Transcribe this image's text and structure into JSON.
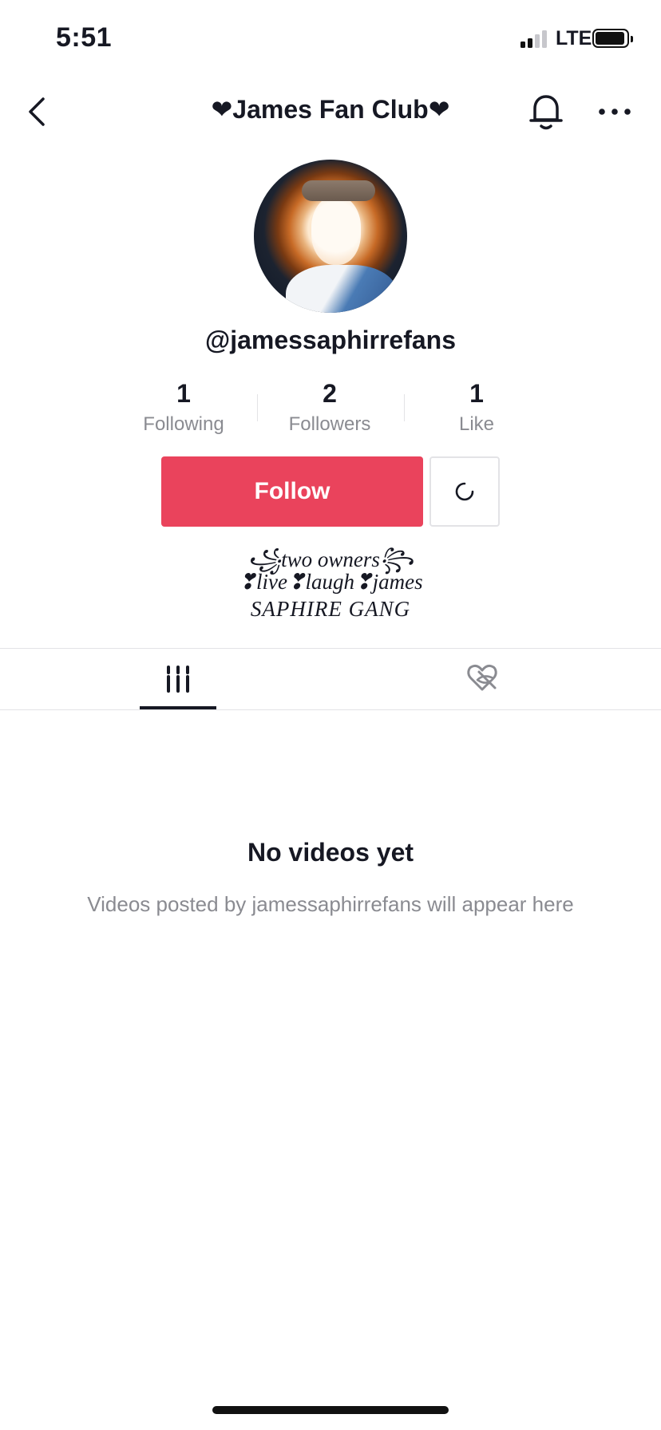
{
  "status_bar": {
    "time": "5:51",
    "network": "LTE",
    "signal_icon": "cellular-signal-icon",
    "battery_icon": "battery-icon"
  },
  "nav": {
    "title": "❤James Fan Club❤",
    "back_icon": "chevron-left-icon",
    "bell_icon": "bell-icon",
    "more_icon": "more-dots-icon"
  },
  "profile": {
    "handle": "@jamessaphirrefans",
    "stats": [
      {
        "value": "1",
        "label": "Following"
      },
      {
        "value": "2",
        "label": "Followers"
      },
      {
        "value": "1",
        "label": "Like"
      }
    ],
    "follow_label": "Follow",
    "bio": [
      "꧁two owners꧂",
      "❣live❣laugh❣james",
      "SAPHIRE GANG"
    ]
  },
  "tabs": [
    {
      "name": "videos",
      "icon": "grid-lines-icon",
      "active": true
    },
    {
      "name": "liked",
      "icon": "heart-hidden-icon",
      "active": false
    }
  ],
  "empty_state": {
    "title": "No videos yet",
    "subtitle": "Videos posted by jamessaphirrefans will appear here"
  },
  "colors": {
    "accent": "#ea435c",
    "text": "#161823",
    "muted": "#8a8b91",
    "divider": "#e3e3e6"
  }
}
